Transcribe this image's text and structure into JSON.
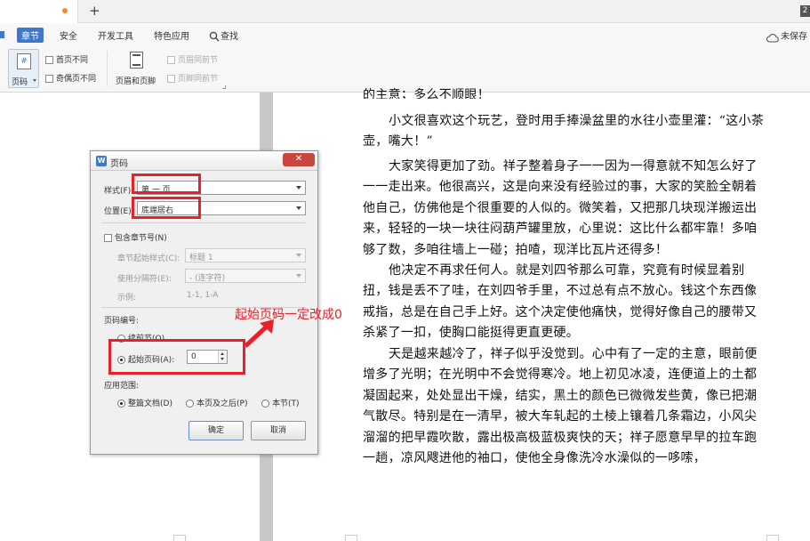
{
  "titlebar": {
    "new_tab": "+",
    "badge": "2"
  },
  "menu": {
    "items": [
      "章节",
      "安全",
      "开发工具",
      "特色应用",
      "查找"
    ],
    "save_status": "未保存"
  },
  "ribbon": {
    "page_number": "页码",
    "first_page_diff": "首页不同",
    "odd_even_diff": "奇偶页不同",
    "header_footer": "页眉和页脚",
    "header_same": "页眉同前节",
    "footer_same": "页脚同前节"
  },
  "document": {
    "paragraphs": [
      "的主意；多么不顺眼！",
      "小文很喜欢这个玩艺，登时用手捧澡盆里的水往小壶里灌：“这小茶壶，嘴大！”",
      "大家笑得更加了劲。祥子整着身子一一因为一得意就不知怎么好了一一走出来。他很高兴，这是向来没有经验过的事，大家的笑脸全朝着他自己，仿佛他是个很重要的人似的。微笑着，又把那几块现洋搬运出来，轻轻的一块一块往闷葫芦罐里放，心里说：这比什么都牢靠！多咱够了数，多咱往墙上一碰；拍喳，现洋比瓦片还得多！",
      "他决定不再求任何人。就是刘四爷那么可靠，究竟有时候显着别扭，钱是丢不了哇，在刘四爷手里，不过总有点不放心。钱这个东西像戒指，总是在自己手上好。这个决定使他痛快，觉得好像自己的腰带又杀紧了一扣，使胸口能挺得更直更硬。",
      "天是越来越冷了，祥子似乎没觉到。心中有了一定的主意，眼前便增多了光明；在光明中不会觉得寒冷。地上初见冰凌，连便道上的土都凝固起来，处处显出干燥，结实，黑土的颜色已微微发些黄，像已把潮气散尽。特别是在一清早，被大车轧起的土棱上镶着几条霜边，小风尖溜溜的把早霞吹散，露出极高极蓝极爽快的天；祥子愿意早早的拉车跑一趟，凉风飕进他的袖口，使他全身像洗冷水澡似的一哆嗦，"
    ]
  },
  "dialog": {
    "title": "页码",
    "style_label": "样式(F):",
    "style_value": "第 一 页",
    "position_label": "位置(E):",
    "position_value": "底端居右",
    "include_chapter": "包含章节号(N)",
    "chapter_style_label": "章节起始样式(C):",
    "chapter_style_value": "标题 1",
    "separator_label": "使用分隔符(E):",
    "separator_value": "-    (连字符)",
    "example_label": "示例:",
    "example_value": "1-1, 1-A",
    "numbering_label": "页码编号:",
    "continue_prev": "续前节(O)",
    "start_at_label": "起始页码(A):",
    "start_at_value": "0",
    "scope_label": "应用范围:",
    "scope_whole": "整篇文档(D)",
    "scope_after": "本页及之后(P)",
    "scope_section": "本节(T)",
    "ok": "确定",
    "cancel": "取消"
  },
  "annotation": {
    "text": "起始页码一定改成0",
    "color": "#e8202a"
  },
  "colors": {
    "accent": "#3c79cc",
    "highlight": "#e8202a"
  }
}
